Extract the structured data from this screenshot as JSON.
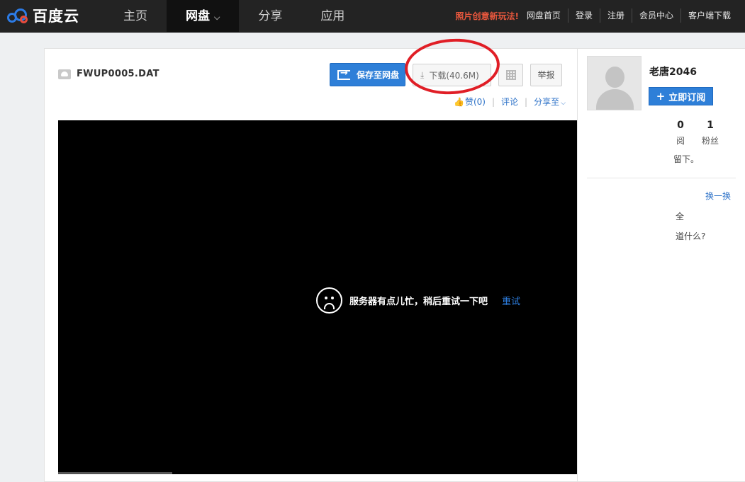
{
  "brand": {
    "logo_text": "百度云",
    "colors": {
      "accent_blue": "#2e7fd8",
      "logo_red": "#e84c3d",
      "promo": "#e8573d",
      "annotation_red": "#e01e26"
    }
  },
  "nav": {
    "items": [
      {
        "label": "主页"
      },
      {
        "label": "网盘"
      },
      {
        "label": "分享"
      },
      {
        "label": "应用"
      }
    ],
    "dropdown_glyph": "⌵"
  },
  "top_links": {
    "promo": "照片创意新玩法!",
    "items": [
      "网盘首页",
      "登录",
      "注册",
      "会员中心",
      "客户端下载"
    ]
  },
  "file": {
    "name": "FWUP0005.DAT",
    "icon": "cloud-icon"
  },
  "toolbar": {
    "save_label": "保存至网盘",
    "download_label": "下载(40.6M)",
    "download_icon": "⤓",
    "qr_icon": "qr-code-icon",
    "report_label": "举报"
  },
  "actions": {
    "like_icon": "👍",
    "like_label": "赞(0)",
    "comment_label": "评论",
    "share_label": "分享至",
    "share_chevron": "⌵"
  },
  "player": {
    "error_message": "服务器有点儿忙，稍后重试一下吧",
    "retry_label": "重试"
  },
  "sidebar": {
    "username": "老唐2046",
    "subscribe_plus": "+",
    "subscribe_label": "立即订阅",
    "stats": [
      {
        "num": "0",
        "label": "阅"
      },
      {
        "num": "1",
        "label": "粉丝"
      }
    ],
    "fragments": [
      "留下。",
      "全",
      "道什么?"
    ],
    "swap_label": "换一换"
  }
}
